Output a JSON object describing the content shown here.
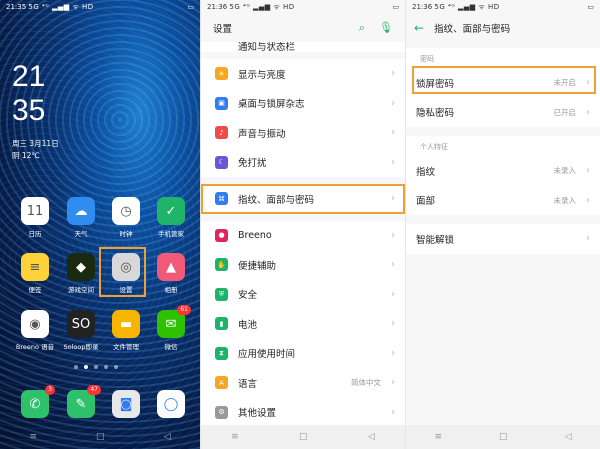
{
  "home": {
    "status": {
      "time": "21:35",
      "signal": "5G ⁴ᴳ ▂▄▆ ᯤ HD",
      "battery": "▭"
    },
    "clock_hour": "21",
    "clock_min": "35",
    "date_line": "周三  3月11日",
    "weather_line": "阴 12℃",
    "apps": [
      {
        "label": "日历",
        "icon": "calendar-icon",
        "glyph": "11",
        "color": "#ffffff"
      },
      {
        "label": "天气",
        "icon": "weather-icon",
        "glyph": "☁",
        "color": "#2f8df0"
      },
      {
        "label": "时钟",
        "icon": "clock-icon",
        "glyph": "◷",
        "color": "#ffffff"
      },
      {
        "label": "手机管家",
        "icon": "shield-icon",
        "glyph": "✓",
        "color": "#1fb46a"
      },
      {
        "label": "便签",
        "icon": "notes-icon",
        "glyph": "≡",
        "color": "#ffd23a"
      },
      {
        "label": "游戏空间",
        "icon": "game-icon",
        "glyph": "◆",
        "color": "#1a2a10"
      },
      {
        "label": "设置",
        "icon": "settings-icon",
        "glyph": "◎",
        "color": "#d8d8d8"
      },
      {
        "label": "相册",
        "icon": "photos-icon",
        "glyph": "▲",
        "color": "#f05a78"
      },
      {
        "label": "Breeno 语音",
        "icon": "breeno-icon",
        "glyph": "◉",
        "color": "#ffffff"
      },
      {
        "label": "Soloop即录",
        "icon": "soloop-icon",
        "glyph": "SO",
        "color": "#222222"
      },
      {
        "label": "文件管理",
        "icon": "folder-icon",
        "glyph": "▬",
        "color": "#f7b500"
      },
      {
        "label": "微信",
        "icon": "wechat-icon",
        "glyph": "✉",
        "color": "#2dc100",
        "badge": "61"
      }
    ],
    "dock": [
      {
        "icon": "phone-icon",
        "glyph": "✆",
        "color": "#2dc16a",
        "badge": "3"
      },
      {
        "icon": "messages-icon",
        "glyph": "✎",
        "color": "#2dc16a",
        "badge": "47"
      },
      {
        "icon": "camera-icon",
        "glyph": "◙",
        "color": "#e8e8e8"
      },
      {
        "icon": "browser-icon",
        "glyph": "◯",
        "color": "#ffffff"
      }
    ],
    "nav": [
      "≡",
      "□",
      "◁"
    ]
  },
  "settings": {
    "status": {
      "time": "21:36",
      "signal": "5G ⁴ᴳ ▂▄▆ ᯤ HD",
      "battery": "▭"
    },
    "title": "设置",
    "partial_top": "通知与状态栏",
    "items": [
      {
        "label": "显示与亮度",
        "icon": "brightness-icon",
        "color": "#f5a623"
      },
      {
        "label": "桌面与锁屏杂志",
        "icon": "wallpaper-icon",
        "color": "#2f7df0"
      },
      {
        "label": "声音与振动",
        "icon": "sound-icon",
        "color": "#f04a4a"
      },
      {
        "label": "免打扰",
        "icon": "moon-icon",
        "color": "#6a56d8"
      },
      {
        "label": "指纹、面部与密码",
        "icon": "fingerprint-icon",
        "color": "#2f7df0"
      },
      {
        "label": "Breeno",
        "icon": "breeno-icon",
        "color": "#e0245e"
      },
      {
        "label": "便捷辅助",
        "icon": "assist-icon",
        "color": "#1db369"
      },
      {
        "label": "安全",
        "icon": "security-icon",
        "color": "#1db369"
      },
      {
        "label": "电池",
        "icon": "battery-icon",
        "color": "#1db369"
      },
      {
        "label": "应用使用时间",
        "icon": "hourglass-icon",
        "color": "#1db369"
      },
      {
        "label": "语言",
        "icon": "language-icon",
        "color": "#f5a623",
        "value": "简体中文"
      },
      {
        "label": "其他设置",
        "icon": "gear-icon",
        "color": "#999999"
      }
    ],
    "nav": [
      "≡",
      "□",
      "◁"
    ]
  },
  "security": {
    "status": {
      "time": "21:36",
      "signal": "5G ⁴ᴳ ▂▄▆ ᯤ HD",
      "battery": "▭"
    },
    "title": "指纹、面部与密码",
    "section1": "密码",
    "lock_password": {
      "label": "锁屏密码",
      "value": "未开启"
    },
    "privacy_password": {
      "label": "隐私密码",
      "value": "已开启"
    },
    "section2": "个人特征",
    "fingerprint": {
      "label": "指纹",
      "value": "未录入"
    },
    "face": {
      "label": "面部",
      "value": "未录入"
    },
    "smart_unlock": {
      "label": "智能解锁"
    },
    "nav": [
      "≡",
      "□",
      "◁"
    ]
  }
}
